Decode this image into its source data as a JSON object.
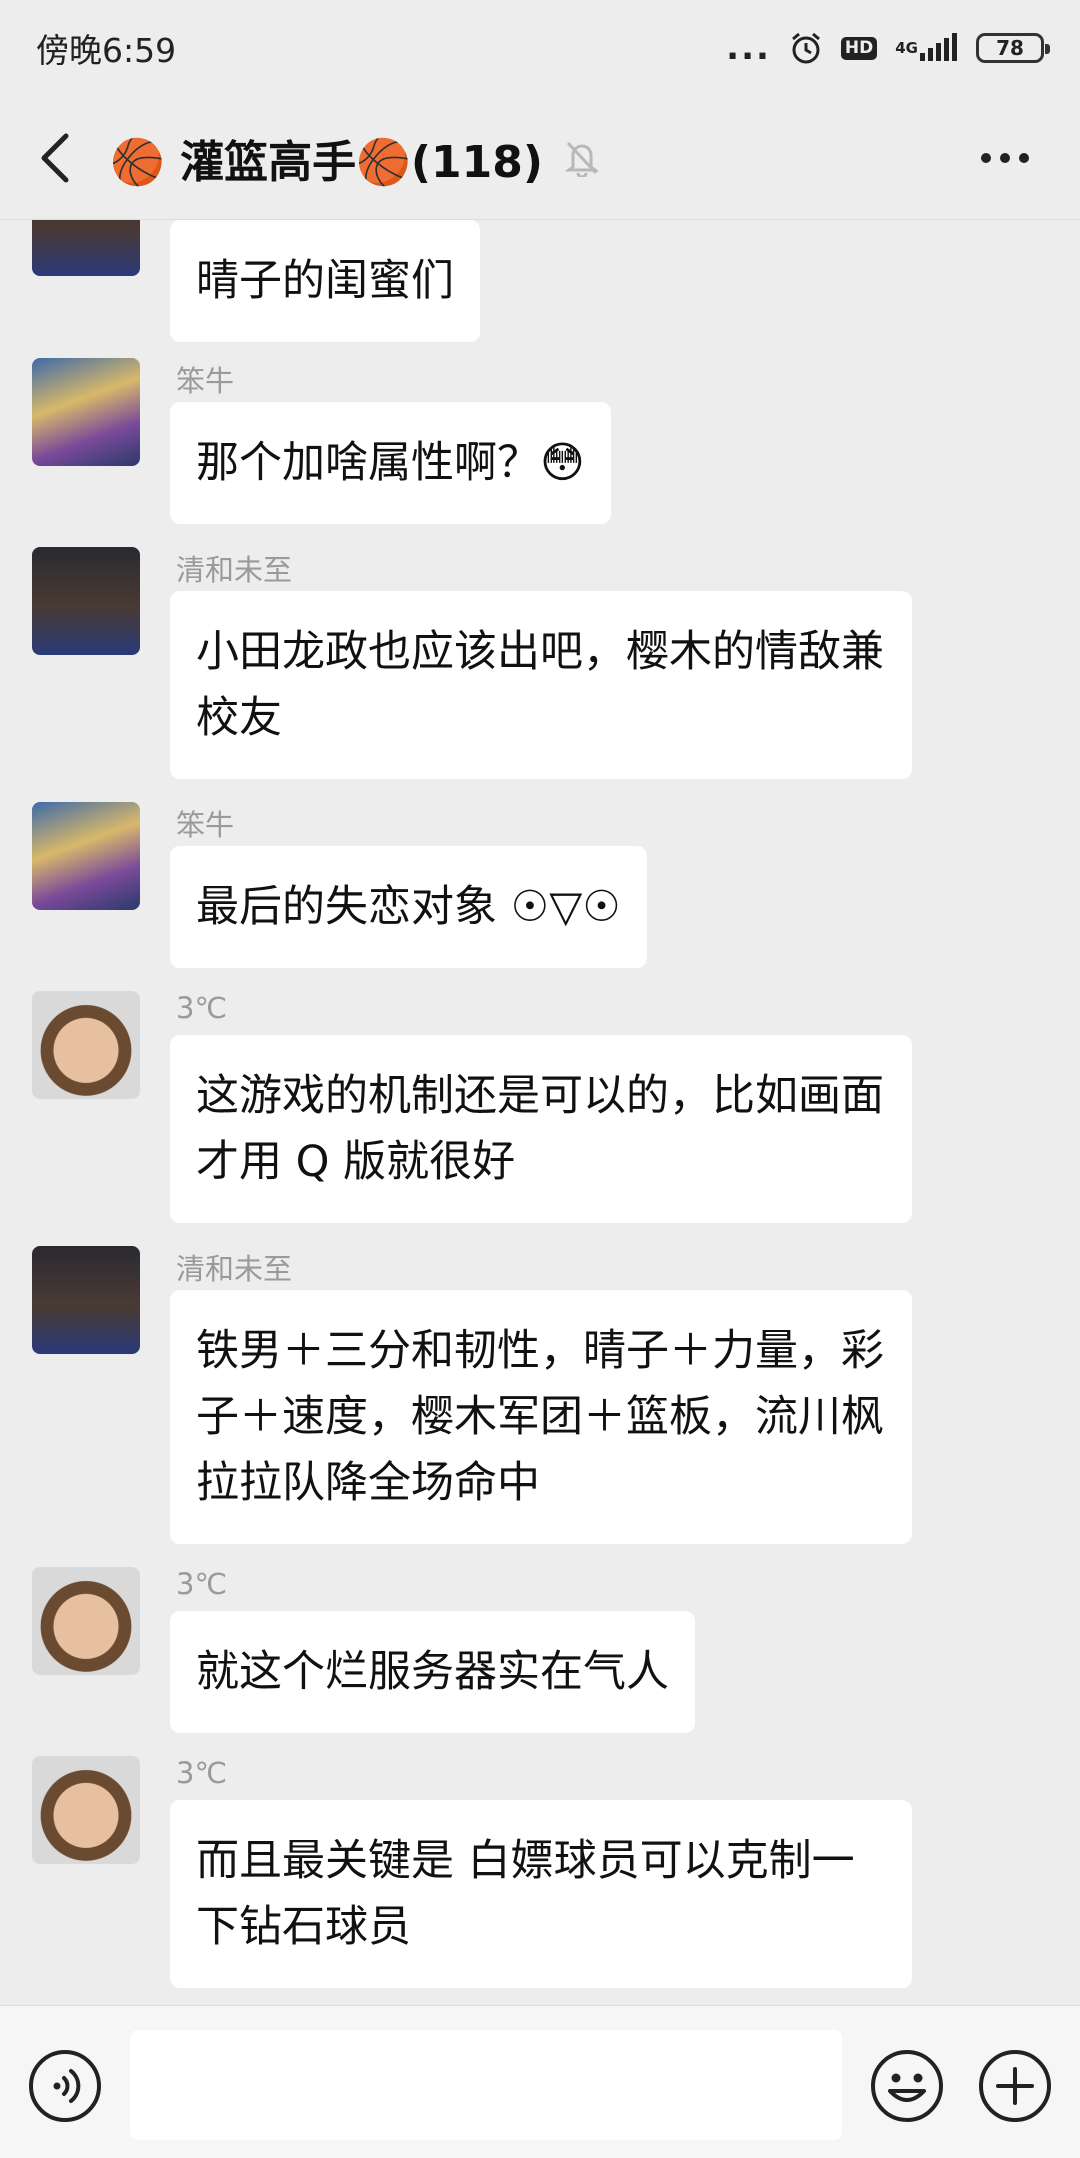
{
  "status_bar": {
    "time": "傍晚6:59",
    "more": "...",
    "hd": "HD",
    "network": "4G",
    "battery": "78"
  },
  "header": {
    "title": "🏀 灌篮高手🏀(118)"
  },
  "messages": [
    {
      "sender": "",
      "text": "晴子的闺蜜们",
      "avatar": "basketball-avatar"
    },
    {
      "sender": "笨牛",
      "text": "那个加啥属性啊？😳",
      "avatar": "anime-avatar"
    },
    {
      "sender": "清和未至",
      "text": "小田龙政也应该出吧，樱木的情敌兼校友",
      "avatar": "basketball-avatar"
    },
    {
      "sender": "笨牛",
      "text": "最后的失恋对象 ☉▽☉",
      "avatar": "anime-avatar"
    },
    {
      "sender": "3℃",
      "text": "这游戏的机制还是可以的，比如画面才用 Q 版就很好",
      "avatar": "man-avatar"
    },
    {
      "sender": "清和未至",
      "text": "铁男＋三分和韧性，晴子＋力量，彩子＋速度，樱木军团＋篮板，流川枫拉拉队降全场命中",
      "avatar": "basketball-avatar"
    },
    {
      "sender": "3℃",
      "text": "就这个烂服务器实在气人",
      "avatar": "man-avatar"
    },
    {
      "sender": "3℃",
      "text": "而且最关键是 白嫖球员可以克制一下钻石球员",
      "avatar": "man-avatar"
    }
  ],
  "input_bar": {
    "placeholder": "",
    "value": ""
  },
  "colors": {
    "background": "#ededed",
    "bubble": "#ffffff",
    "sender_name": "#9a9a9a"
  }
}
